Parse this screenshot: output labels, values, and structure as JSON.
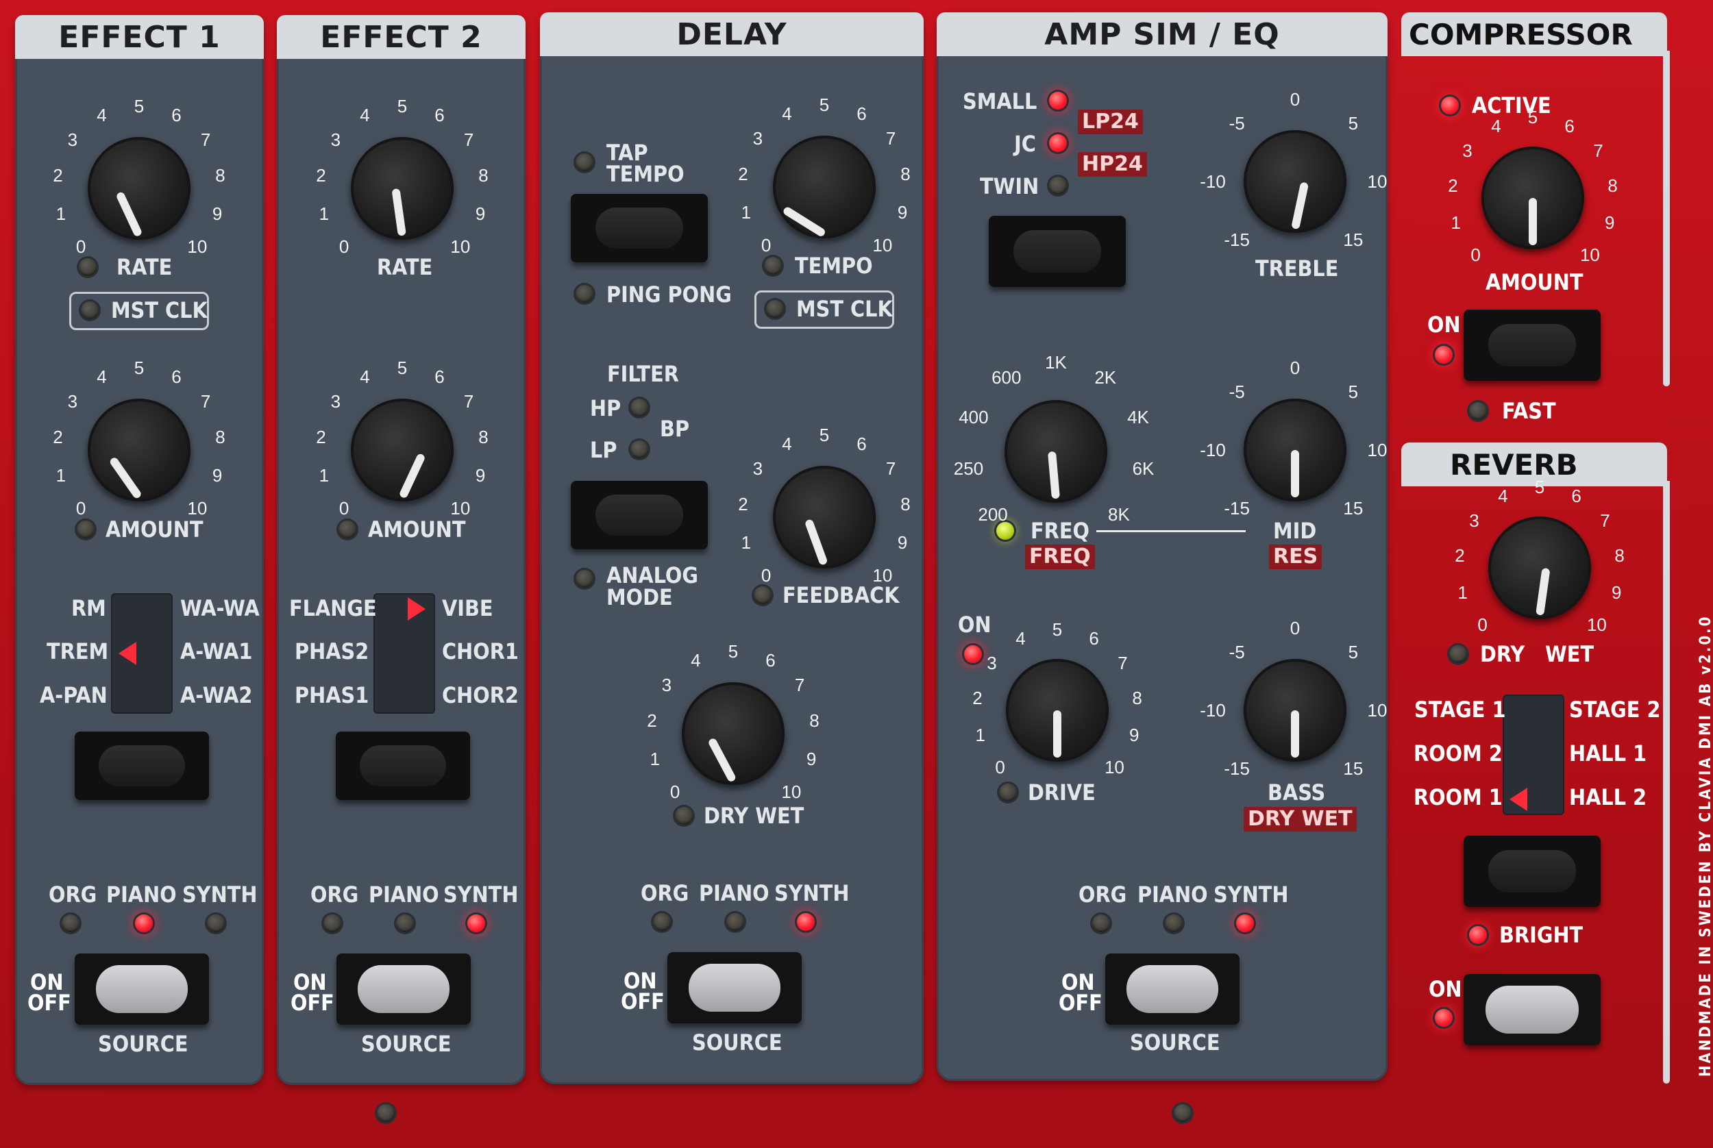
{
  "effect1": {
    "title": "EFFECT 1",
    "rate_label": "RATE",
    "mst_clk": "MST CLK",
    "amount_label": "AMOUNT",
    "types_left": [
      "RM",
      "TREM",
      "A-PAN"
    ],
    "types_right": [
      "WA-WA",
      "A-WA1",
      "A-WA2"
    ],
    "selected": "TREM",
    "source": [
      "ORG",
      "PIANO",
      "SYNTH"
    ],
    "source_active": "PIANO",
    "on": "ON",
    "off": "OFF",
    "source_label": "SOURCE"
  },
  "effect2": {
    "title": "EFFECT 2",
    "rate_label": "RATE",
    "amount_label": "AMOUNT",
    "types_left": [
      "FLANGE",
      "PHAS2",
      "PHAS1"
    ],
    "types_right": [
      "VIBE",
      "CHOR1",
      "CHOR2"
    ],
    "selected": "VIBE",
    "source": [
      "ORG",
      "PIANO",
      "SYNTH"
    ],
    "source_active": "SYNTH",
    "on": "ON",
    "off": "OFF",
    "source_label": "SOURCE"
  },
  "delay": {
    "title": "DELAY",
    "tap_tempo": "TAP TEMPO",
    "tap": "TAP",
    "tempo_word": "TEMPO",
    "ping_pong": "PING PONG",
    "tempo_label": "TEMPO",
    "mst_clk": "MST CLK",
    "filter": "FILTER",
    "hp": "HP",
    "bp": "BP",
    "lp": "LP",
    "analog": "ANALOG",
    "mode": "MODE",
    "feedback_label": "FEEDBACK",
    "drywet_label": "DRY WET",
    "source": [
      "ORG",
      "PIANO",
      "SYNTH"
    ],
    "source_active": "SYNTH",
    "on": "ON",
    "off": "OFF",
    "source_label": "SOURCE"
  },
  "amp": {
    "title": "AMP SIM / EQ",
    "types": [
      "SMALL",
      "JC",
      "TWIN"
    ],
    "lp24": "LP24",
    "hp24": "HP24",
    "treble": "TREBLE",
    "treble_ticks": [
      "-15",
      "-10",
      "-5",
      "0",
      "5",
      "10",
      "15"
    ],
    "freq_ticks": [
      "200",
      "250",
      "400",
      "600",
      "1K",
      "2K",
      "4K",
      "6K",
      "8K"
    ],
    "freq_label": "FREQ",
    "freq_tag": "FREQ",
    "mid_label": "MID",
    "res_tag": "RES",
    "on": "ON",
    "drive_label": "DRIVE",
    "bass_label": "BASS",
    "drywet_tag": "DRY WET",
    "source": [
      "ORG",
      "PIANO",
      "SYNTH"
    ],
    "source_active": "SYNTH",
    "on2": "ON",
    "off": "OFF",
    "source_label": "SOURCE"
  },
  "compressor": {
    "title": "COMPRESSOR",
    "active": "ACTIVE",
    "amount_label": "AMOUNT",
    "on": "ON",
    "fast": "FAST"
  },
  "reverb": {
    "title": "REVERB",
    "dry": "DRY",
    "wet": "WET",
    "types_left": [
      "STAGE 1",
      "ROOM 2",
      "ROOM 1"
    ],
    "types_right": [
      "STAGE 2",
      "HALL 1",
      "HALL 2"
    ],
    "selected": "HALL 2",
    "bright": "BRIGHT",
    "on": "ON"
  },
  "ticks": {
    "zero_ten": [
      "0",
      "1",
      "2",
      "3",
      "4",
      "5",
      "6",
      "7",
      "8",
      "9",
      "10"
    ]
  },
  "credit": "HANDMADE IN SWEDEN BY CLAVIA DMI AB  v2.0.0"
}
